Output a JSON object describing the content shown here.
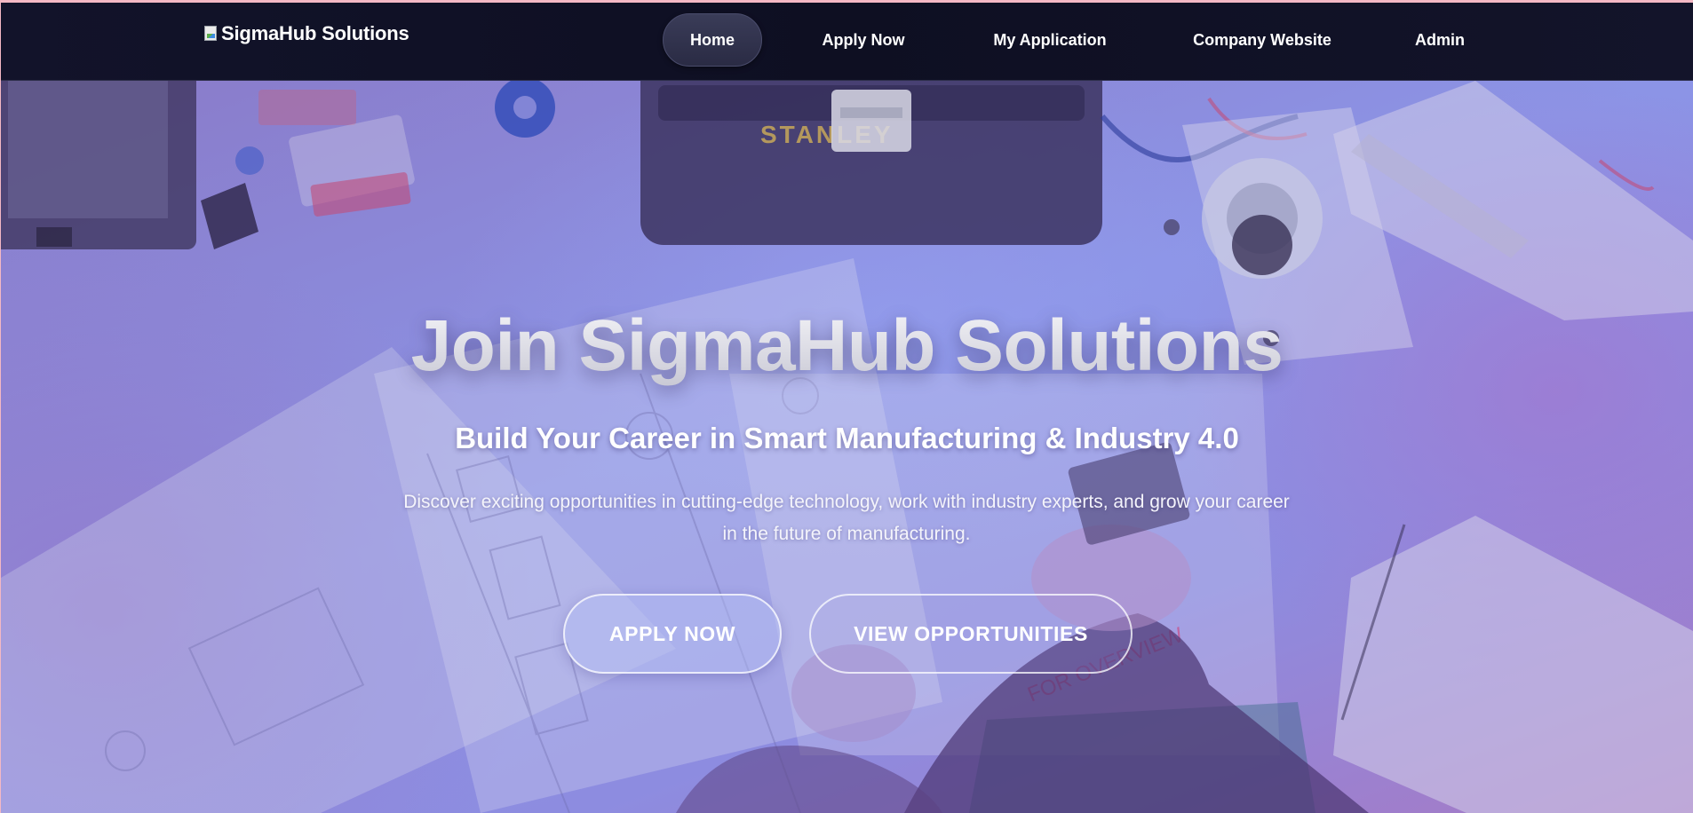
{
  "brand": {
    "logo_alt": "SigmaHub Solutions"
  },
  "nav": {
    "items": [
      {
        "label": "Home",
        "active": true
      },
      {
        "label": "Apply Now",
        "active": false
      },
      {
        "label": "My Application",
        "active": false
      },
      {
        "label": "Company Website",
        "active": false
      },
      {
        "label": "Admin",
        "active": false
      }
    ]
  },
  "hero": {
    "title": "Join SigmaHub Solutions",
    "subtitle": "Build Your Career in Smart Manufacturing & Industry 4.0",
    "description": "Discover exciting opportunities in cutting-edge technology, work with industry experts, and grow your career in the future of manufacturing.",
    "primary_cta": "APPLY NOW",
    "secondary_cta": "VIEW OPPORTUNITIES",
    "background_brand_text": "STANLEY",
    "background_stamp_text": "FOR OVERVIEW"
  },
  "colors": {
    "navbar_bg": "#0e0f22",
    "hero_overlay": "#8c94e6",
    "accent_purple": "#a679c4"
  }
}
